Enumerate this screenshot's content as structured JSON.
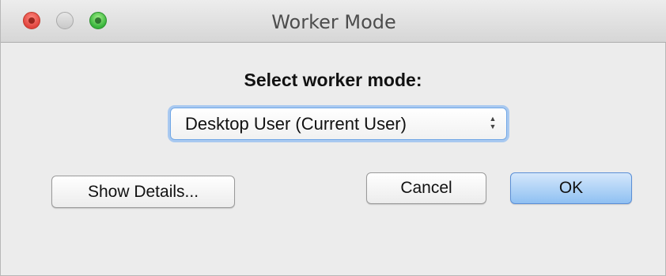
{
  "window": {
    "title": "Worker Mode",
    "controls": [
      "close-icon",
      "minimize-icon",
      "zoom-icon"
    ],
    "accent": "#6fa6e6"
  },
  "dialog": {
    "heading": "Select worker mode:",
    "mode_select": {
      "selected": "Desktop User (Current User)"
    },
    "buttons": {
      "details": "Show Details...",
      "cancel": "Cancel",
      "ok": "OK"
    }
  }
}
